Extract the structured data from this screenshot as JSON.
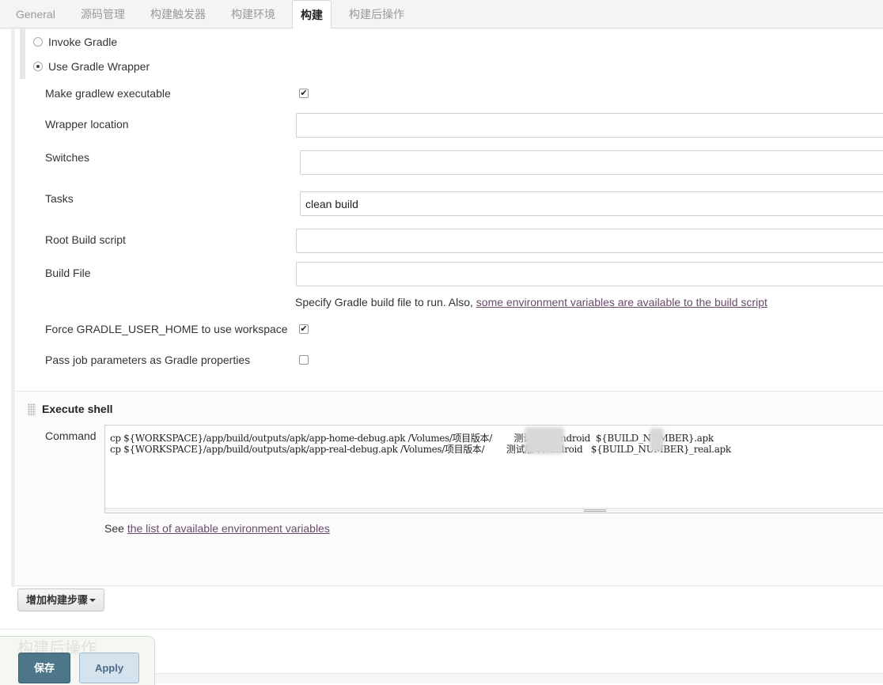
{
  "tabs": [
    {
      "label": "General",
      "active": false
    },
    {
      "label": "源码管理",
      "active": false
    },
    {
      "label": "构建触发器",
      "active": false
    },
    {
      "label": "构建环境",
      "active": false
    },
    {
      "label": "构建",
      "active": true
    },
    {
      "label": "构建后操作",
      "active": false
    }
  ],
  "gradle": {
    "invoke_gradle": {
      "label": "Invoke Gradle",
      "checked": false
    },
    "use_wrapper": {
      "label": "Use Gradle Wrapper",
      "checked": true
    },
    "make_executable": {
      "label": "Make gradlew executable",
      "checked": true
    },
    "wrapper_location": {
      "label": "Wrapper location",
      "value": ""
    },
    "switches": {
      "label": "Switches",
      "value": ""
    },
    "tasks": {
      "label": "Tasks",
      "value": "clean build"
    },
    "root_build_script": {
      "label": "Root Build script",
      "value": ""
    },
    "build_file": {
      "label": "Build File",
      "value": ""
    },
    "build_file_help": "Specify Gradle build file to run. Also, ",
    "build_file_help_link": "some environment variables are available to the build script",
    "force_user_home": {
      "label": "Force GRADLE_USER_HOME to use workspace",
      "checked": true
    },
    "pass_job_params": {
      "label": "Pass job parameters as Gradle properties",
      "checked": false
    }
  },
  "execute_shell": {
    "title": "Execute shell",
    "command_label": "Command",
    "command_lines": [
      "cp ${WORKSPACE}/app/build/outputs/apk/app-home-debug.apk /Volumes/项目版本/        测试版本/Android  ${BUILD_NUMBER}.apk",
      "cp ${WORKSPACE}/app/build/outputs/apk/app-real-debug.apk /Volumes/项目版本/        测试版本/Android   ${BUILD_NUMBER}_real.apk"
    ],
    "see_prefix": "See ",
    "see_link": "the list of available environment variables"
  },
  "add_build_step": "增加构建步骤",
  "post_build_heading": "构建后操作",
  "buttons": {
    "save": "保存",
    "apply": "Apply"
  },
  "colors": {
    "save_bg": "#4d7688",
    "apply_bg": "#d5e3ef",
    "link": "#6a4a6b"
  }
}
